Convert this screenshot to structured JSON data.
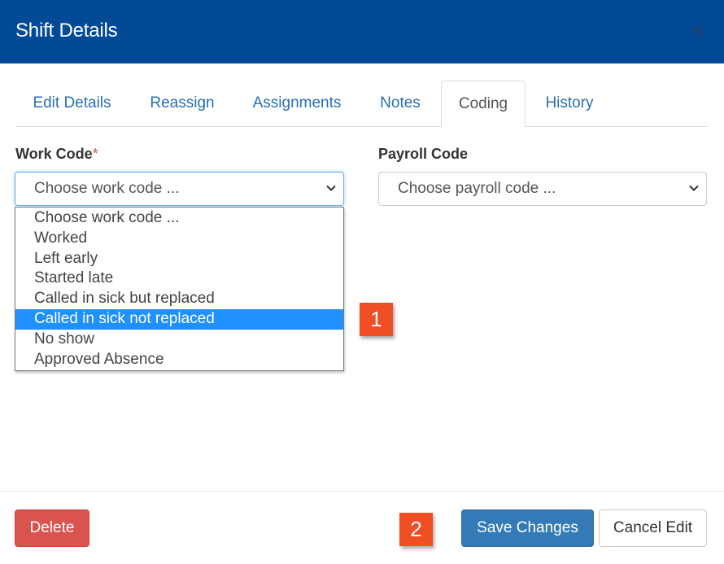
{
  "dialog": {
    "title": "Shift Details",
    "close_icon": "close-icon"
  },
  "tabs": [
    {
      "label": "Edit Details"
    },
    {
      "label": "Reassign"
    },
    {
      "label": "Assignments"
    },
    {
      "label": "Notes"
    },
    {
      "label": "Coding",
      "active": true
    },
    {
      "label": "History"
    }
  ],
  "work_code": {
    "label": "Work Code",
    "required_marker": "*",
    "value": "Choose work code ...",
    "options": [
      "Choose work code ...",
      "Worked",
      "Left early",
      "Started late",
      "Called in sick but replaced",
      "Called in sick not replaced",
      "No show",
      "Approved Absence"
    ],
    "highlighted_option": "Called in sick not replaced"
  },
  "payroll_code": {
    "label": "Payroll Code",
    "value": "Choose payroll code ..."
  },
  "callouts": [
    "1",
    "2"
  ],
  "footer": {
    "delete_label": "Delete",
    "save_label": "Save Changes",
    "cancel_label": "Cancel Edit"
  },
  "colors": {
    "header": "#034a96",
    "tab_link": "#2a6fb5",
    "highlight": "#1e90ff",
    "danger": "#d9534f",
    "primary": "#337ab7",
    "callout": "#f04e23"
  }
}
